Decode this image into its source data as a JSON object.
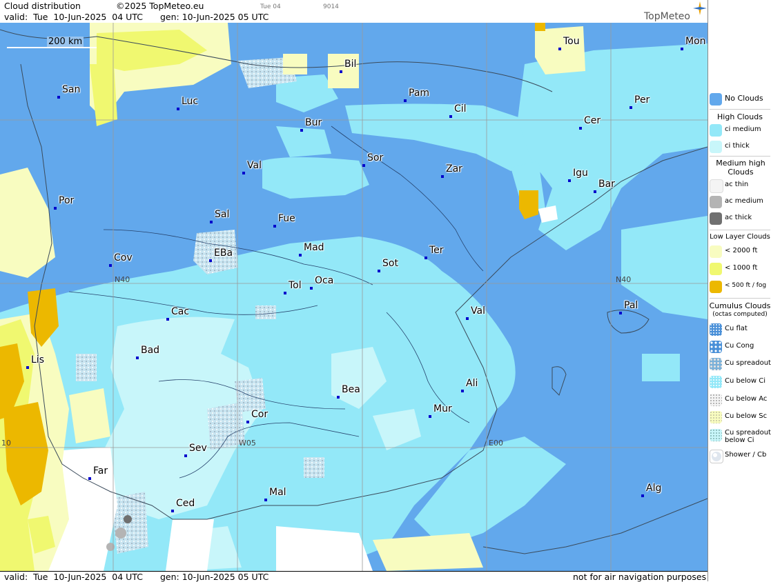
{
  "header": {
    "title": "Cloud distribution",
    "copyright": "©2025 TopMeteo.eu",
    "valid": "valid:  Tue  10-Jun-2025  04 UTC",
    "gen": "gen: 10-Jun-2025 05 UTC",
    "small1": "Tue 04",
    "small2": "9014",
    "logo": "TopMeteo"
  },
  "map": {
    "scale_label": "200 km",
    "grid_labels": [
      "N40",
      "N40",
      "W05",
      "E00",
      "10"
    ],
    "cities": [
      "Tou",
      "Mon",
      "Bil",
      "San",
      "Luc",
      "Pam",
      "Cil",
      "Per",
      "Cer",
      "Bur",
      "Sor",
      "Val",
      "Zar",
      "Igu",
      "Bar",
      "Por",
      "Sal",
      "Fue",
      "Mad",
      "EBa",
      "Cov",
      "Ter",
      "Sot",
      "Tol",
      "Oca",
      "Pal",
      "Cac",
      "Val",
      "Bad",
      "Lis",
      "Ali",
      "Bea",
      "Mur",
      "Cor",
      "Sev",
      "Far",
      "Mal",
      "Alg",
      "Ced"
    ]
  },
  "footer": {
    "valid": "valid:  Tue  10-Jun-2025  04 UTC",
    "gen": "gen: 10-Jun-2025 05 UTC",
    "disclaimer": "not for air navigation purposes"
  },
  "legend": {
    "no_clouds": "No Clouds",
    "high_title": "High Clouds",
    "ci_medium": "ci medium",
    "ci_thick": "ci thick",
    "medium_title": "Medium high Clouds",
    "ac_thin": "ac thin",
    "ac_medium": "ac medium",
    "ac_thick": "ac thick",
    "low_title": "Low Layer Clouds",
    "low_2000": "< 2000 ft",
    "low_1000": "< 1000 ft",
    "low_500": "< 500 ft / fog",
    "cu_title": "Cumulus Clouds",
    "cu_sub": "(octas computed)",
    "cu_flat": "Cu flat",
    "cu_cong": "Cu Cong",
    "cu_spread": "Cu spreadout",
    "cu_below_ci": "Cu below Ci",
    "cu_below_ac": "Cu below Ac",
    "cu_below_sc": "Cu below Sc",
    "cu_spread_ci": "Cu spreadout below Ci",
    "shower": "Shower / Cb"
  },
  "colors": {
    "no_clouds": "#62a8ec",
    "ci_medium": "#93e8f8",
    "ci_thick": "#c8f6fa",
    "ac_thin": "#f4f4f4",
    "ac_medium": "#b4b4b4",
    "ac_thick": "#707070",
    "low_2000": "#f8fcc0",
    "low_1000": "#f0f870",
    "low_500": "#ecb800"
  }
}
